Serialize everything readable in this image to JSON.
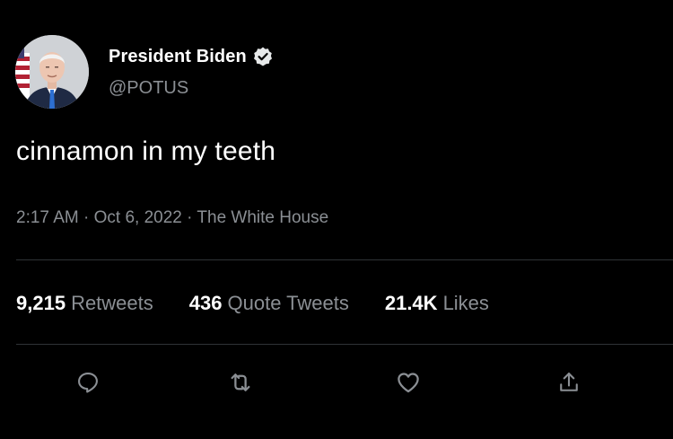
{
  "user": {
    "display_name": "President Biden",
    "handle": "@POTUS",
    "avatar_icon": "presidential-portrait-avatar",
    "verified_icon": "verified-badge-icon"
  },
  "tweet": {
    "text": "cinnamon in my teeth",
    "time": "2:17 AM",
    "date": "Oct 6, 2022",
    "source": "The White House",
    "separator": " · "
  },
  "stats": {
    "retweets_count": "9,215",
    "retweets_label": "Retweets",
    "quotes_count": "436",
    "quotes_label": "Quote Tweets",
    "likes_count": "21.4K",
    "likes_label": "Likes"
  },
  "actions": {
    "reply_icon": "reply-icon",
    "retweet_icon": "retweet-icon",
    "like_icon": "heart-icon",
    "share_icon": "share-icon"
  },
  "colors": {
    "background": "#000000",
    "primary_text": "#ffffff",
    "secondary_text": "#8b8f94",
    "divider": "#2f3336"
  }
}
